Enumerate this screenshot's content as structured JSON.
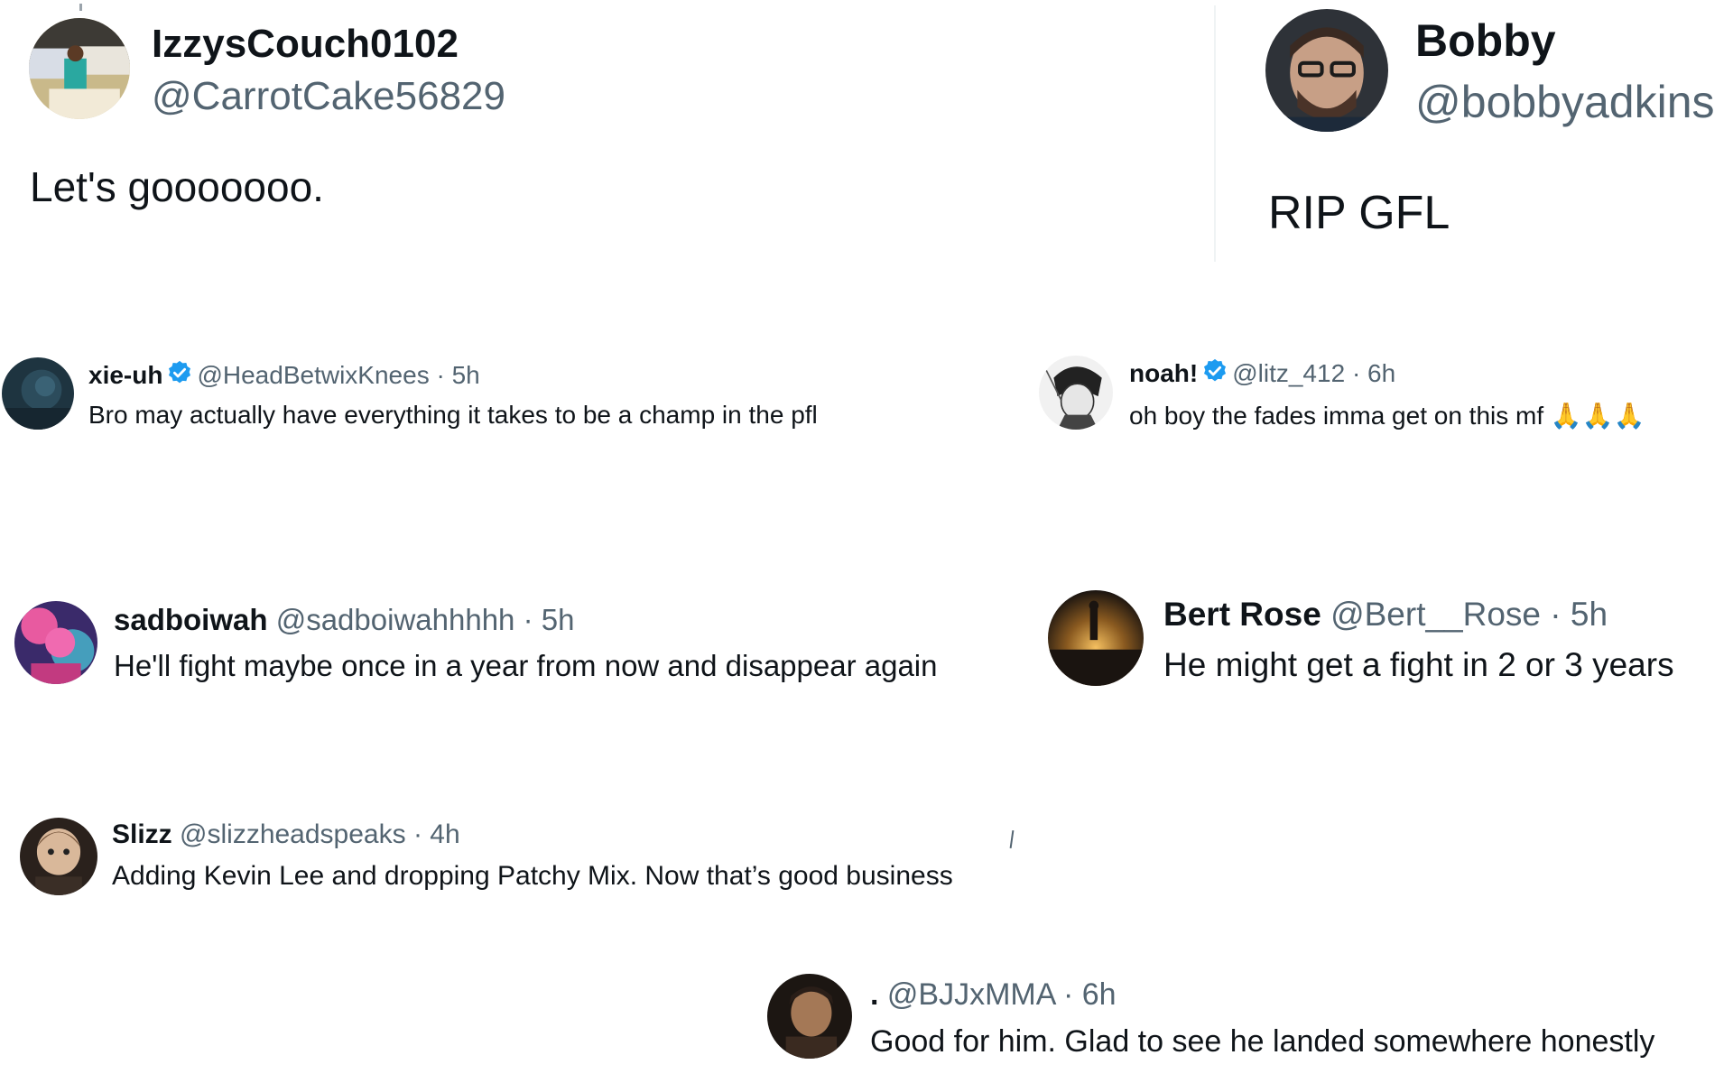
{
  "posts": [
    {
      "name": "IzzysCouch0102",
      "handle": "@CarrotCake56829",
      "text": "Let's gooooooo."
    },
    {
      "name": "Bobby",
      "handle": "@bobbyadkins",
      "text": "RIP GFL"
    },
    {
      "name": "xie-uh",
      "handle": "@HeadBetwixKnees",
      "time": "· 5h",
      "text": "Bro may actually have everything it takes to be a champ in the pfl",
      "verified": true
    },
    {
      "name": "noah!",
      "handle": "@litz_412",
      "time": "· 6h",
      "text": "oh boy the fades imma get on this mf",
      "emoji": "🙏🙏🙏",
      "verified": true
    },
    {
      "name": "sadboiwah",
      "handle": "@sadboiwahhhhh",
      "time": "· 5h",
      "text": "He'll fight maybe once in a year from now and disappear again"
    },
    {
      "name": "Bert Rose",
      "handle": "@Bert__Rose",
      "time": "· 5h",
      "text": "He might get a fight in 2 or 3 years"
    },
    {
      "name": "Slizz",
      "handle": "@slizzheadspeaks",
      "time": "· 4h",
      "text": "Adding Kevin Lee and dropping Patchy Mix. Now that’s good business"
    },
    {
      "name": ".",
      "handle": "@BJJxMMA",
      "time": "· 6h",
      "text": "Good for him. Glad to see he landed somewhere honestly"
    }
  ],
  "icons": {
    "verified": "verified-badge-icon",
    "verified_color": "#1d9bf0"
  }
}
